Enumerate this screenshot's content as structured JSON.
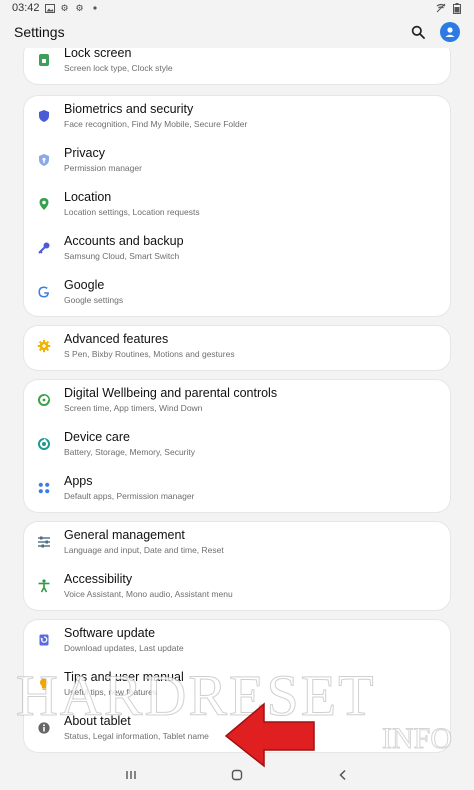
{
  "status_bar": {
    "time": "03:42"
  },
  "app_bar": {
    "title": "Settings"
  },
  "groups": [
    {
      "items": [
        {
          "title": "Lock screen",
          "subtitle": "Screen lock type, Clock style",
          "icon": "lock-icon",
          "color": "#3e9e5c"
        }
      ]
    },
    {
      "items": [
        {
          "title": "Biometrics and security",
          "subtitle": "Face recognition, Find My Mobile, Secure Folder",
          "icon": "shield-icon",
          "color": "#4a5bd6"
        },
        {
          "title": "Privacy",
          "subtitle": "Permission manager",
          "icon": "privacy-shield-icon",
          "color": "#6a8fe0"
        },
        {
          "title": "Location",
          "subtitle": "Location settings, Location requests",
          "icon": "location-pin-icon",
          "color": "#37a050"
        },
        {
          "title": "Accounts and backup",
          "subtitle": "Samsung Cloud, Smart Switch",
          "icon": "key-icon",
          "color": "#4a5bd6"
        },
        {
          "title": "Google",
          "subtitle": "Google settings",
          "icon": "google-icon",
          "color": "#3a7ee8"
        }
      ]
    },
    {
      "items": [
        {
          "title": "Advanced features",
          "subtitle": "S Pen, Bixby Routines, Motions and gestures",
          "icon": "gear-plus-icon",
          "color": "#f0b400"
        }
      ]
    },
    {
      "items": [
        {
          "title": "Digital Wellbeing and parental controls",
          "subtitle": "Screen time, App timers, Wind Down",
          "icon": "wellbeing-icon",
          "color": "#3aa04a"
        },
        {
          "title": "Device care",
          "subtitle": "Battery, Storage, Memory, Security",
          "icon": "device-care-icon",
          "color": "#1f9a8c"
        },
        {
          "title": "Apps",
          "subtitle": "Default apps, Permission manager",
          "icon": "apps-grid-icon",
          "color": "#3a7ee8"
        }
      ]
    },
    {
      "items": [
        {
          "title": "General management",
          "subtitle": "Language and input, Date and time, Reset",
          "icon": "sliders-icon",
          "color": "#4d6b80"
        },
        {
          "title": "Accessibility",
          "subtitle": "Voice Assistant, Mono audio, Assistant menu",
          "icon": "accessibility-icon",
          "color": "#2e9a44"
        }
      ]
    },
    {
      "items": [
        {
          "title": "Software update",
          "subtitle": "Download updates, Last update",
          "icon": "software-update-icon",
          "color": "#5a6be0"
        },
        {
          "title": "Tips and user manual",
          "subtitle": "Useful tips, new features",
          "icon": "lightbulb-icon",
          "color": "#f0a800"
        },
        {
          "title": "About tablet",
          "subtitle": "Status, Legal information, Tablet name",
          "icon": "info-icon",
          "color": "#666666"
        }
      ]
    }
  ],
  "watermark": {
    "main": "HARDRESET",
    "sub": "INFO"
  },
  "colors": {
    "accent": "#2c7be5",
    "arrow": "#e02020",
    "background": "#f3f3f3"
  }
}
